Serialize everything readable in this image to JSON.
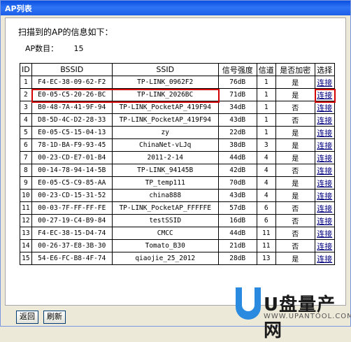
{
  "window": {
    "title": "AP列表"
  },
  "header": {
    "text": "扫描到的AP的信息如下："
  },
  "count": {
    "label": "AP数目：",
    "value": "15"
  },
  "table": {
    "columns": [
      "ID",
      "BSSID",
      "SSID",
      "信号强度",
      "信道",
      "是否加密",
      "选择"
    ],
    "rows": [
      {
        "id": "1",
        "bssid": "F4-EC-38-09-62-F2",
        "ssid": "TP-LINK_0962F2",
        "signal": "76dB",
        "channel": "1",
        "encrypted": "是",
        "action": "连接"
      },
      {
        "id": "2",
        "bssid": "E0-05-C5-20-26-BC",
        "ssid": "TP-LINK_2026BC",
        "signal": "71dB",
        "channel": "1",
        "encrypted": "是",
        "action": "连接"
      },
      {
        "id": "3",
        "bssid": "B0-48-7A-41-9F-94",
        "ssid": "TP-LINK_PocketAP_419F94",
        "signal": "34dB",
        "channel": "1",
        "encrypted": "否",
        "action": "连接"
      },
      {
        "id": "4",
        "bssid": "D8-5D-4C-D2-28-33",
        "ssid": "TP-LINK_PocketAP_419F94",
        "signal": "43dB",
        "channel": "1",
        "encrypted": "否",
        "action": "连接"
      },
      {
        "id": "5",
        "bssid": "E0-05-C5-15-04-13",
        "ssid": "zy",
        "signal": "22dB",
        "channel": "1",
        "encrypted": "是",
        "action": "连接"
      },
      {
        "id": "6",
        "bssid": "78-1D-BA-F9-93-45",
        "ssid": "ChinaNet-vLJq",
        "signal": "38dB",
        "channel": "3",
        "encrypted": "是",
        "action": "连接"
      },
      {
        "id": "7",
        "bssid": "00-23-CD-E7-01-B4",
        "ssid": "2011-2-14",
        "signal": "44dB",
        "channel": "4",
        "encrypted": "是",
        "action": "连接"
      },
      {
        "id": "8",
        "bssid": "00-14-78-94-14-5B",
        "ssid": "TP-LINK_94145B",
        "signal": "42dB",
        "channel": "4",
        "encrypted": "否",
        "action": "连接"
      },
      {
        "id": "9",
        "bssid": "E0-05-C5-C9-85-AA",
        "ssid": "TP_temp111",
        "signal": "70dB",
        "channel": "4",
        "encrypted": "是",
        "action": "连接"
      },
      {
        "id": "10",
        "bssid": "00-23-CD-15-31-52",
        "ssid": "china888",
        "signal": "43dB",
        "channel": "4",
        "encrypted": "是",
        "action": "连接"
      },
      {
        "id": "11",
        "bssid": "00-03-7F-FF-FF-FE",
        "ssid": "TP-LINK_PocketAP_FFFFFE",
        "signal": "57dB",
        "channel": "6",
        "encrypted": "否",
        "action": "连接"
      },
      {
        "id": "12",
        "bssid": "00-27-19-C4-B9-84",
        "ssid": "testSSID",
        "signal": "16dB",
        "channel": "6",
        "encrypted": "否",
        "action": "连接"
      },
      {
        "id": "13",
        "bssid": "F4-EC-38-15-D4-74",
        "ssid": "CMCC",
        "signal": "44dB",
        "channel": "11",
        "encrypted": "否",
        "action": "连接"
      },
      {
        "id": "14",
        "bssid": "00-26-37-E8-3B-30",
        "ssid": "Tomato_B30",
        "signal": "21dB",
        "channel": "11",
        "encrypted": "否",
        "action": "连接"
      },
      {
        "id": "15",
        "bssid": "54-E6-FC-B8-4F-74",
        "ssid": "qiaojie_25_2012",
        "signal": "28dB",
        "channel": "13",
        "encrypted": "是",
        "action": "连接"
      }
    ]
  },
  "buttons": {
    "back": "返回",
    "refresh": "刷新"
  },
  "watermark": {
    "brand": "U盘量产网",
    "url": "WWW.UPANTOOL.COM"
  },
  "colors": {
    "titlebar": "#0a4fe0",
    "highlight": "#d40000",
    "link": "#000080"
  }
}
